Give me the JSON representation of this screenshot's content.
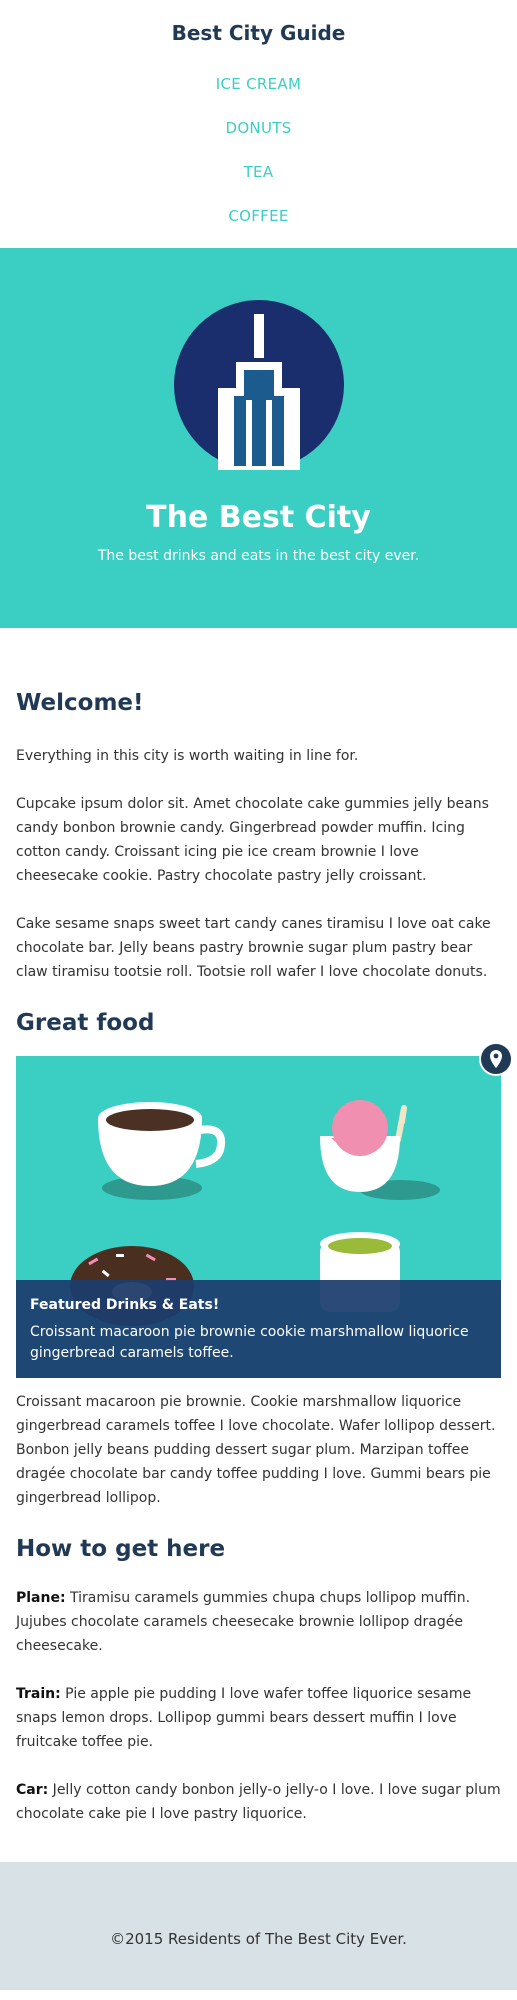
{
  "header": {
    "site_title": "Best City Guide",
    "nav": [
      {
        "label": "ICE CREAM"
      },
      {
        "label": "DONUTS"
      },
      {
        "label": "TEA"
      },
      {
        "label": "COFFEE"
      }
    ]
  },
  "hero": {
    "title": "The Best City",
    "subtitle": "The best drinks and eats in the best city ever."
  },
  "welcome": {
    "title": "Welcome!",
    "paragraphs": [
      "Everything in this city is worth waiting in line for.",
      "Cupcake ipsum dolor sit. Amet chocolate cake gummies jelly beans candy bonbon brownie candy. Gingerbread powder muffin. Icing cotton candy. Croissant icing pie ice cream brownie I love cheesecake cookie. Pastry chocolate pastry jelly croissant.",
      "Cake sesame snaps sweet tart candy canes tiramisu I love oat cake chocolate bar. Jelly beans pastry brownie sugar plum pastry bear claw tiramisu tootsie roll. Tootsie roll wafer I love chocolate donuts."
    ]
  },
  "food": {
    "title": "Great food",
    "caption_title": "Featured Drinks & Eats!",
    "caption_text": "Croissant macaroon pie brownie cookie marshmallow liquorice gingerbread caramels toffee.",
    "paragraph": "Croissant macaroon pie brownie. Cookie marshmallow liquorice gingerbread caramels toffee I love chocolate. Wafer lollipop dessert. Bonbon jelly beans pudding dessert sugar plum. Marzipan toffee dragée chocolate bar candy toffee pudding I love. Gummi bears pie gingerbread lollipop."
  },
  "howto": {
    "title": "How to get here",
    "items": [
      {
        "label": "Plane:",
        "text": " Tiramisu caramels gummies chupa chups lollipop muffin. Jujubes chocolate caramels cheesecake brownie lollipop dragée cheesecake."
      },
      {
        "label": "Train:",
        "text": " Pie apple pie pudding I love wafer toffee liquorice sesame snaps lemon drops. Lollipop gummi bears dessert muffin I love fruitcake toffee pie."
      },
      {
        "label": "Car:",
        "text": " Jelly cotton candy bonbon jelly-o jelly-o I love. I love sugar plum chocolate cake pie I love pastry liquorice."
      }
    ]
  },
  "footer": {
    "text": "©2015 Residents of The Best City Ever."
  },
  "colors": {
    "accent": "#3bcec3",
    "navy": "#203a56",
    "logo_circle": "#1a2e6e",
    "building": "#1b5b8e",
    "footer_bg": "#d8e1e6"
  },
  "icons": {
    "logo": "city-building-icon",
    "pin": "map-pin-icon"
  }
}
